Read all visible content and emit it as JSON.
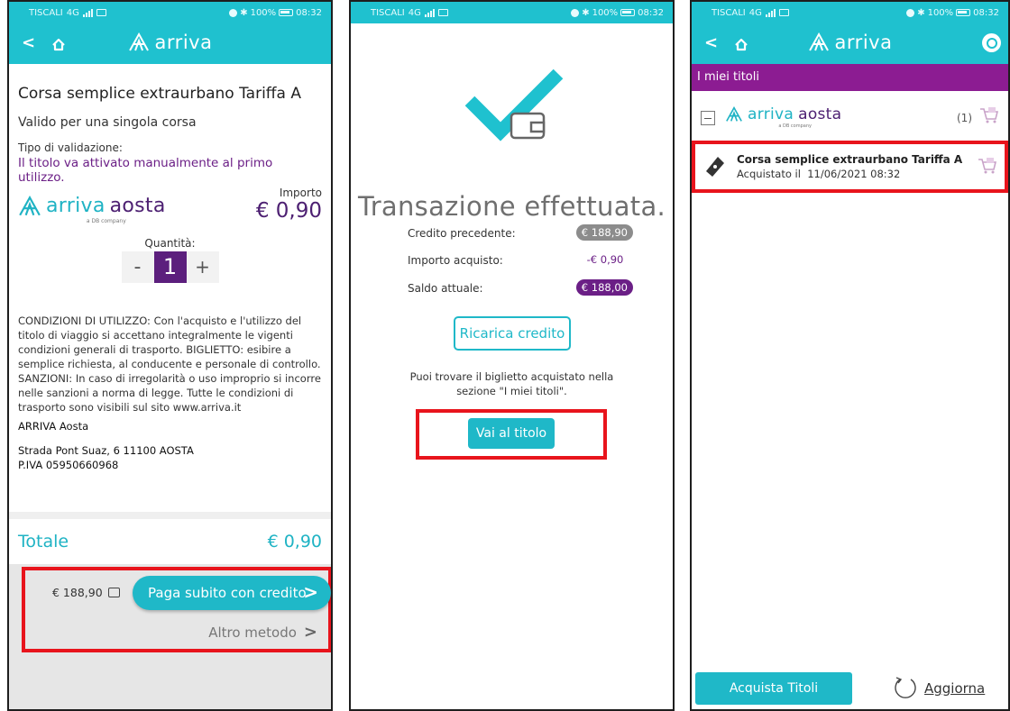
{
  "status": {
    "carrier": "TISCALI",
    "net": "4G",
    "battery": "100%",
    "time": "08:32"
  },
  "brand": {
    "app_logo": "arriva",
    "partner_a": "arriva",
    "partner_b": "aosta",
    "partner_sub": "a DB company"
  },
  "purchase": {
    "title": "Corsa semplice extraurbano Tariffa A",
    "validity": "Valido per una singola corsa",
    "validation_label": "Tipo di validazione:",
    "validation_value": "Il titolo va attivato manualmente al primo utilizzo.",
    "importo_label": "Importo",
    "price": "€ 0,90",
    "quantity_label": "Quantità:",
    "quantity_minus": "-",
    "quantity": "1",
    "quantity_plus": "+",
    "conditions": "CONDIZIONI DI UTILIZZO: Con l'acquisto e l'utilizzo del titolo di viaggio si accettano integralmente le vigenti condizioni generali di trasporto. BIGLIETTO: esibire a semplice richiesta, al conducente e personale di controllo. SANZIONI: In caso di irregolarità o uso improprio si incorre nelle sanzioni a norma di legge. Tutte le condizioni di trasporto sono visibili sul sito www.arriva.it",
    "company": "ARRIVA Aosta",
    "address_line1": "Strada Pont Suaz, 6 11100 AOSTA",
    "address_line2": "P.IVA 05950660968",
    "total_label": "Totale",
    "total_value": "€ 0,90",
    "credit": "€ 188,90",
    "pay_credit_label": "Paga subito con credito",
    "other_method_label": "Altro metodo"
  },
  "confirmation": {
    "title": "Transazione effettuata.",
    "rows": [
      {
        "label": "Credito precedente:",
        "value": "€ 188,90"
      },
      {
        "label": "Importo acquisto:",
        "value": "-€ 0,90"
      },
      {
        "label": "Saldo attuale:",
        "value": "€ 188,00"
      }
    ],
    "recharge_label": "Ricarica credito",
    "note": "Puoi trovare il biglietto acquistato nella sezione \"I miei titoli\".",
    "go_label": "Vai al titolo"
  },
  "titles": {
    "section": "I miei titoli",
    "count": "(1)",
    "ticket_title": "Corsa semplice extraurbano Tariffa A",
    "ticket_date_label": "Acquistato il",
    "ticket_date": "11/06/2021 08:32",
    "buy_label": "Acquista Titoli",
    "refresh_label": "Aggiorna"
  },
  "colors": {
    "teal": "#1fc1cf",
    "purple": "#6b1f86",
    "highlight": "#e8141c"
  }
}
